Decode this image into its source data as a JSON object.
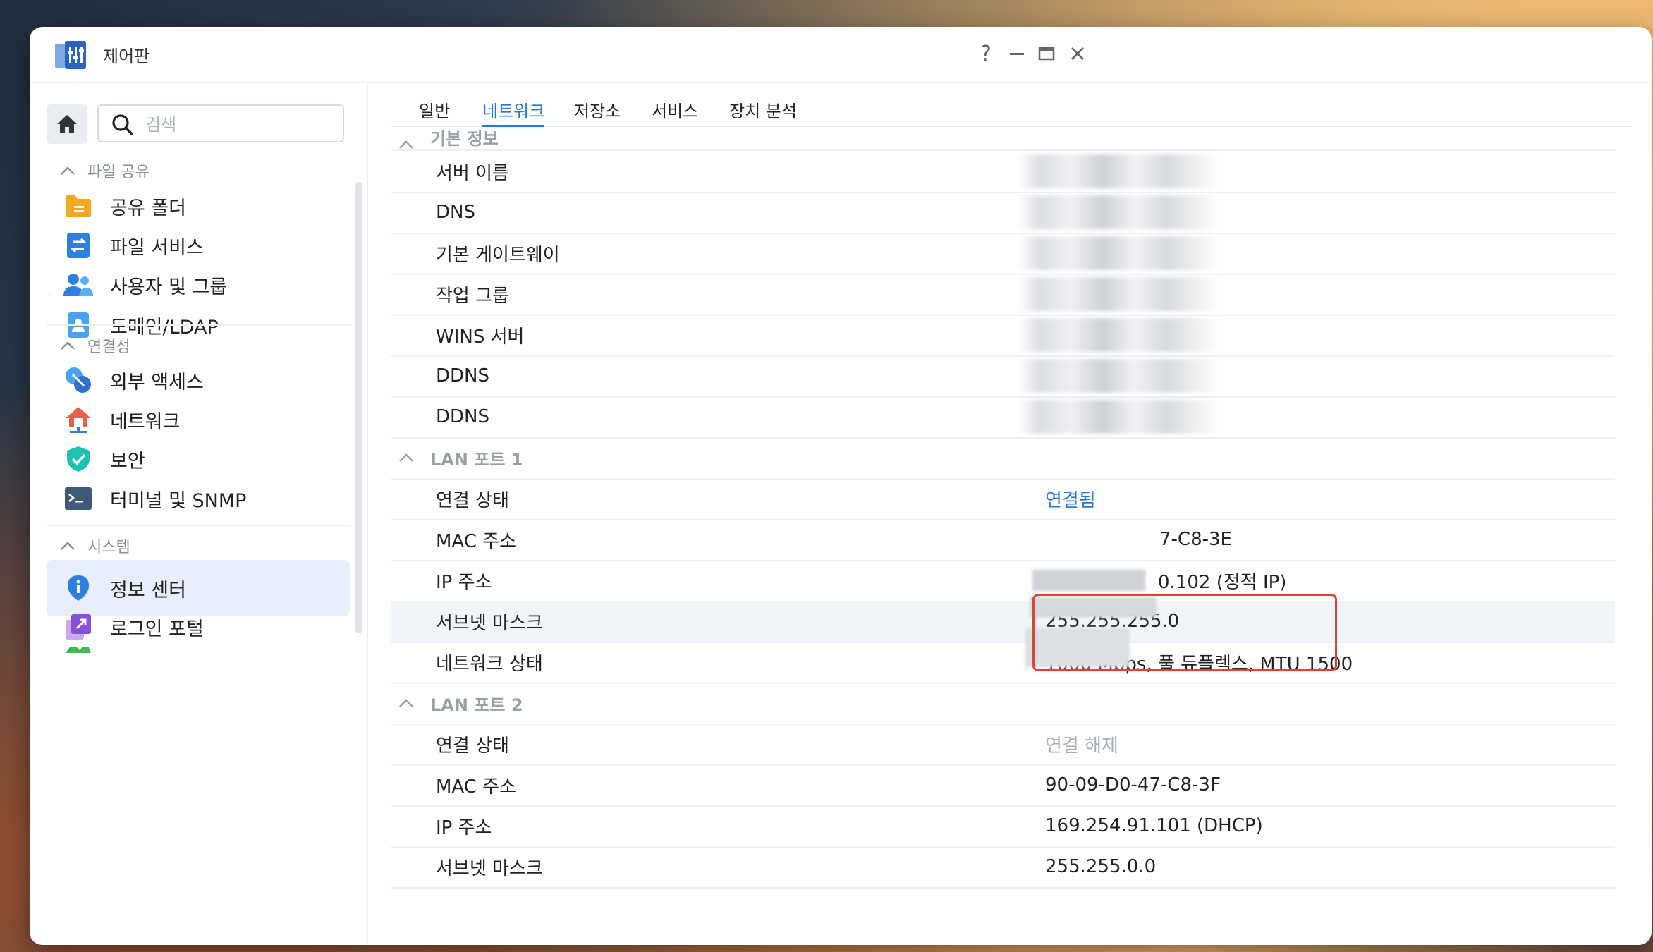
{
  "window": {
    "title": "제어판"
  },
  "window_controls": {
    "help": "?",
    "minimize": "—",
    "maximize": "▭",
    "close": "✕"
  },
  "search": {
    "placeholder": "검색"
  },
  "sidebar": {
    "sections": [
      {
        "label": "파일 공유",
        "items": [
          "공유 폴더",
          "파일 서비스",
          "사용자 및 그룹",
          "도메인/LDAP"
        ]
      },
      {
        "label": "연결성",
        "items": [
          "외부 액세스",
          "네트워크",
          "보안",
          "터미널 및 SNMP"
        ]
      },
      {
        "label": "시스템",
        "items": [
          "정보 센터",
          "로그인 포털"
        ]
      }
    ],
    "active_item": "정보 센터"
  },
  "tabs": [
    "일반",
    "네트워크",
    "저장소",
    "서비스",
    "장치 분석"
  ],
  "active_tab": "네트워크",
  "basic_info": {
    "header": "기본 정보",
    "rows": [
      {
        "key": "서버 이름",
        "value": ""
      },
      {
        "key": "DNS",
        "value": ""
      },
      {
        "key": "기본 게이트웨이",
        "value": ""
      },
      {
        "key": "작업 그룹",
        "value": ""
      },
      {
        "key": "WINS 서버",
        "value": ""
      },
      {
        "key": "DDNS",
        "value": ""
      },
      {
        "key": "DDNS",
        "value": ""
      }
    ]
  },
  "lan1": {
    "header": "LAN 포트 1",
    "rows": [
      {
        "key": "연결 상태",
        "value": "연결됨"
      },
      {
        "key": "MAC 주소",
        "value": "7-C8-3E"
      },
      {
        "key": "IP 주소",
        "value": "0.102 (정적 IP)"
      },
      {
        "key": "서브넷 마스크",
        "value": "255.255.255.0"
      },
      {
        "key": "네트워크 상태",
        "value": "1000 Mbps, 풀 듀플렉스, MTU 1500"
      }
    ]
  },
  "lan2": {
    "header": "LAN 포트 2",
    "rows": [
      {
        "key": "연결 상태",
        "value": "연결 해제"
      },
      {
        "key": "MAC 주소",
        "value": "90-09-D0-47-C8-3F"
      },
      {
        "key": "IP 주소",
        "value": "169.254.91.101 (DHCP)"
      },
      {
        "key": "서브넷 마스크",
        "value": "255.255.0.0"
      }
    ]
  },
  "colors": {
    "accent": "#2679d9",
    "highlight_box": "#e0432f",
    "active_nav_bg": "#e6effb"
  }
}
